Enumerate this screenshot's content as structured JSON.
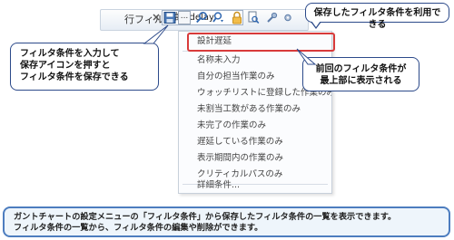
{
  "toolbar": {
    "filter_label": "行フィルタ",
    "filter_input_value": "設計 /delay",
    "more_label": "..."
  },
  "dropdown": {
    "items": [
      {
        "label": "設計遅延"
      },
      {
        "label": "名称未入力"
      },
      {
        "label": "自分の担当作業のみ"
      },
      {
        "label": "ウォッチリストに登録した作業のみ"
      },
      {
        "label": "未割当工数がある作業のみ"
      },
      {
        "label": "未完了の作業のみ"
      },
      {
        "label": "遅延している作業のみ"
      },
      {
        "label": "表示期間内の作業のみ"
      },
      {
        "label": "クリティカルパスのみ"
      },
      {
        "label": "詳細条件..."
      }
    ]
  },
  "callouts": {
    "top": "保存したフィルタ条件を利用できる",
    "left_lines": [
      "フィルタ条件を入力して",
      "保存アイコンを押すと",
      "フィルタ条件を保存できる"
    ],
    "right_lines": [
      "前回のフィルタ条件が",
      "最上部に表示される"
    ]
  },
  "info": {
    "line1": "ガントチャートの設定メニューの「フィルタ条件」から保存したフィルタ条件の一覧を表示できます。",
    "line2": "フィルタ条件の一覧から、フィルタ条件の編集や削除ができます。"
  },
  "colors": {
    "highlight": "#d83a3a",
    "callout_border": "#2c4a8a",
    "info_border": "#4d7dbf",
    "info_bg": "#eef5fb"
  }
}
